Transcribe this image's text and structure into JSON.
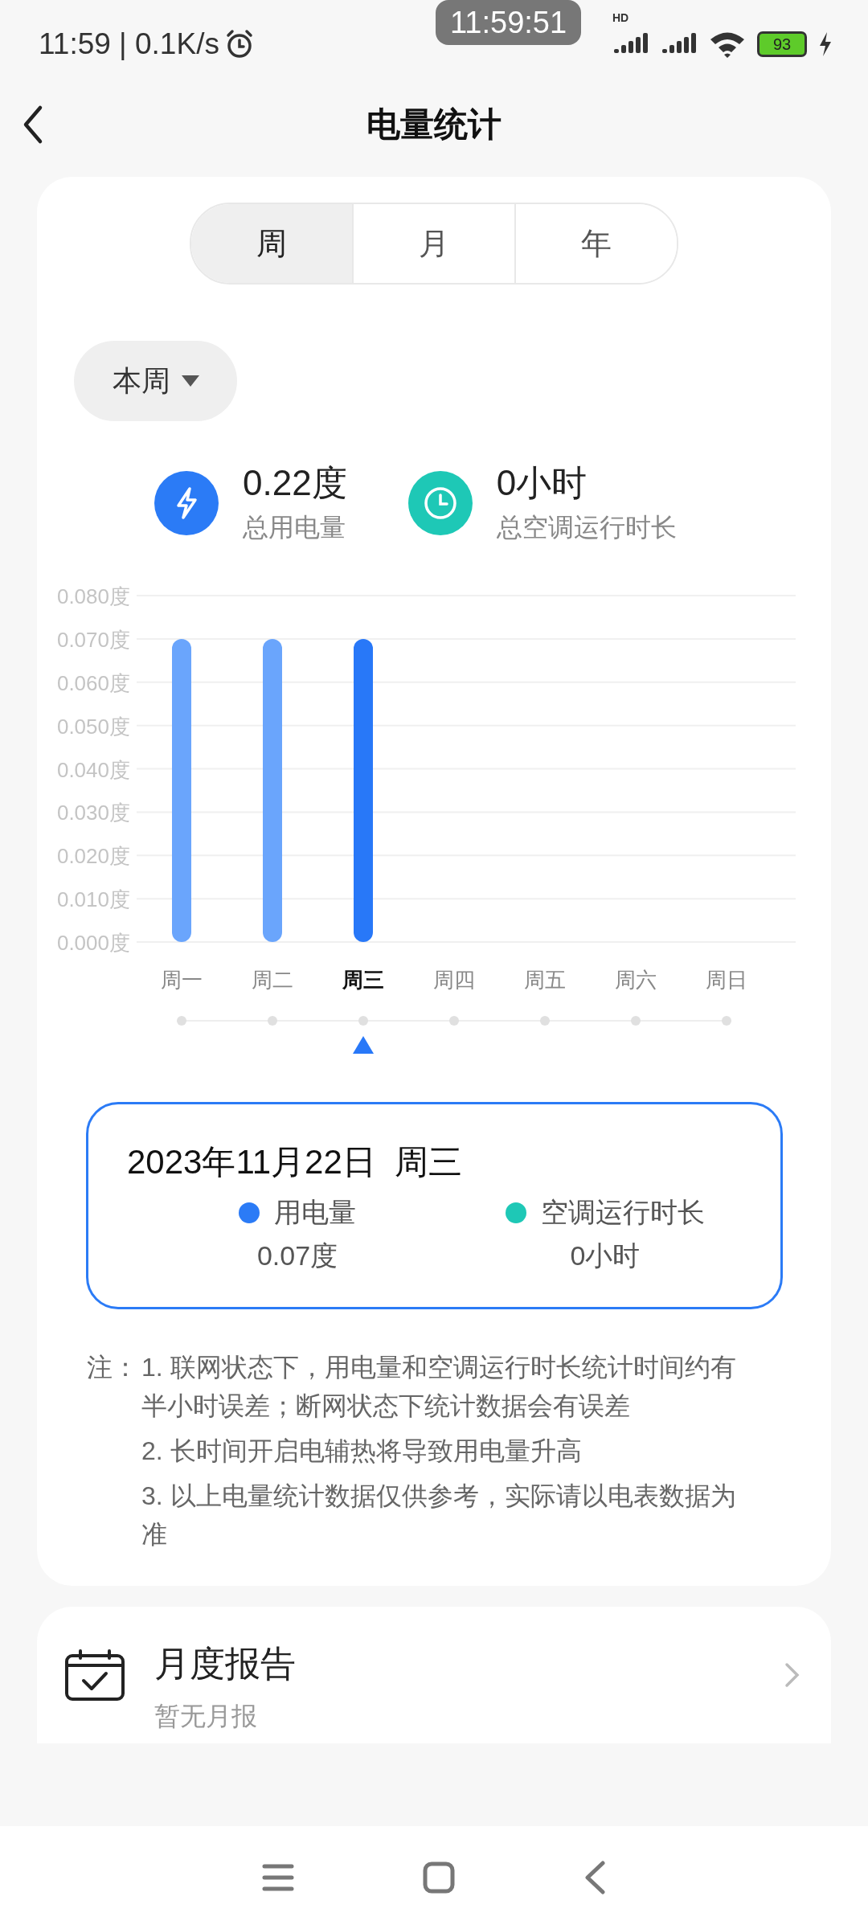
{
  "status_bar": {
    "time": "11:59 | 0.1K/s",
    "clock_pill": "11:59:51",
    "network": "HD",
    "battery": "93"
  },
  "header": {
    "title": "电量统计"
  },
  "tabs": [
    {
      "label": "周",
      "selected": true
    },
    {
      "label": "月",
      "selected": false
    },
    {
      "label": "年",
      "selected": false
    }
  ],
  "period_dropdown": {
    "value": "本周"
  },
  "stats": [
    {
      "value": "0.22度",
      "label": "总用电量",
      "color": "#2b7bf6",
      "kind": "energy"
    },
    {
      "value": "0小时",
      "label": "总空调运行时长",
      "color": "#1ec8b6",
      "kind": "clock"
    }
  ],
  "chart_data": {
    "type": "bar",
    "categories": [
      "周一",
      "周二",
      "周三",
      "周四",
      "周五",
      "周六",
      "周日"
    ],
    "values": [
      0.07,
      0.07,
      0.07,
      null,
      null,
      null,
      null
    ],
    "grid": true,
    "ylim": [
      0,
      0.08
    ],
    "yticks": [
      {
        "value": 0,
        "label": "0.000度"
      },
      {
        "value": 0.01,
        "label": "0.010度"
      },
      {
        "value": 0.02,
        "label": "0.020度"
      },
      {
        "value": 0.03,
        "label": "0.030度"
      },
      {
        "value": 0.04,
        "label": "0.040度"
      },
      {
        "value": 0.05,
        "label": "0.050度"
      },
      {
        "value": 0.06,
        "label": "0.060度"
      },
      {
        "value": 0.07,
        "label": "0.070度"
      },
      {
        "value": 0.08,
        "label": "0.080度"
      }
    ]
  },
  "day_markers": [
    {
      "selected": false
    },
    {
      "selected": false
    },
    {
      "selected": true
    },
    {
      "selected": false
    },
    {
      "selected": false
    },
    {
      "selected": false
    },
    {
      "selected": false
    }
  ],
  "summary": {
    "date": "2023年11月22日  周三",
    "items": [
      {
        "label": "用电量",
        "value": "0.07度",
        "color": "#2b7bf6"
      },
      {
        "label": "空调运行时长",
        "value": "0小时",
        "color": "#1ec8b6"
      }
    ]
  },
  "notes": {
    "label": "注：",
    "items": [
      "1. 联网状态下，用电量和空调运行时长统计时间约有半小时误差；断网状态下统计数据会有误差",
      "2. 长时间开启电辅热将导致用电量升高",
      "3. 以上电量统计数据仅供参考，实际请以电表数据为准"
    ]
  },
  "report": {
    "title": "月度报告",
    "subtitle": "暂无月报"
  }
}
